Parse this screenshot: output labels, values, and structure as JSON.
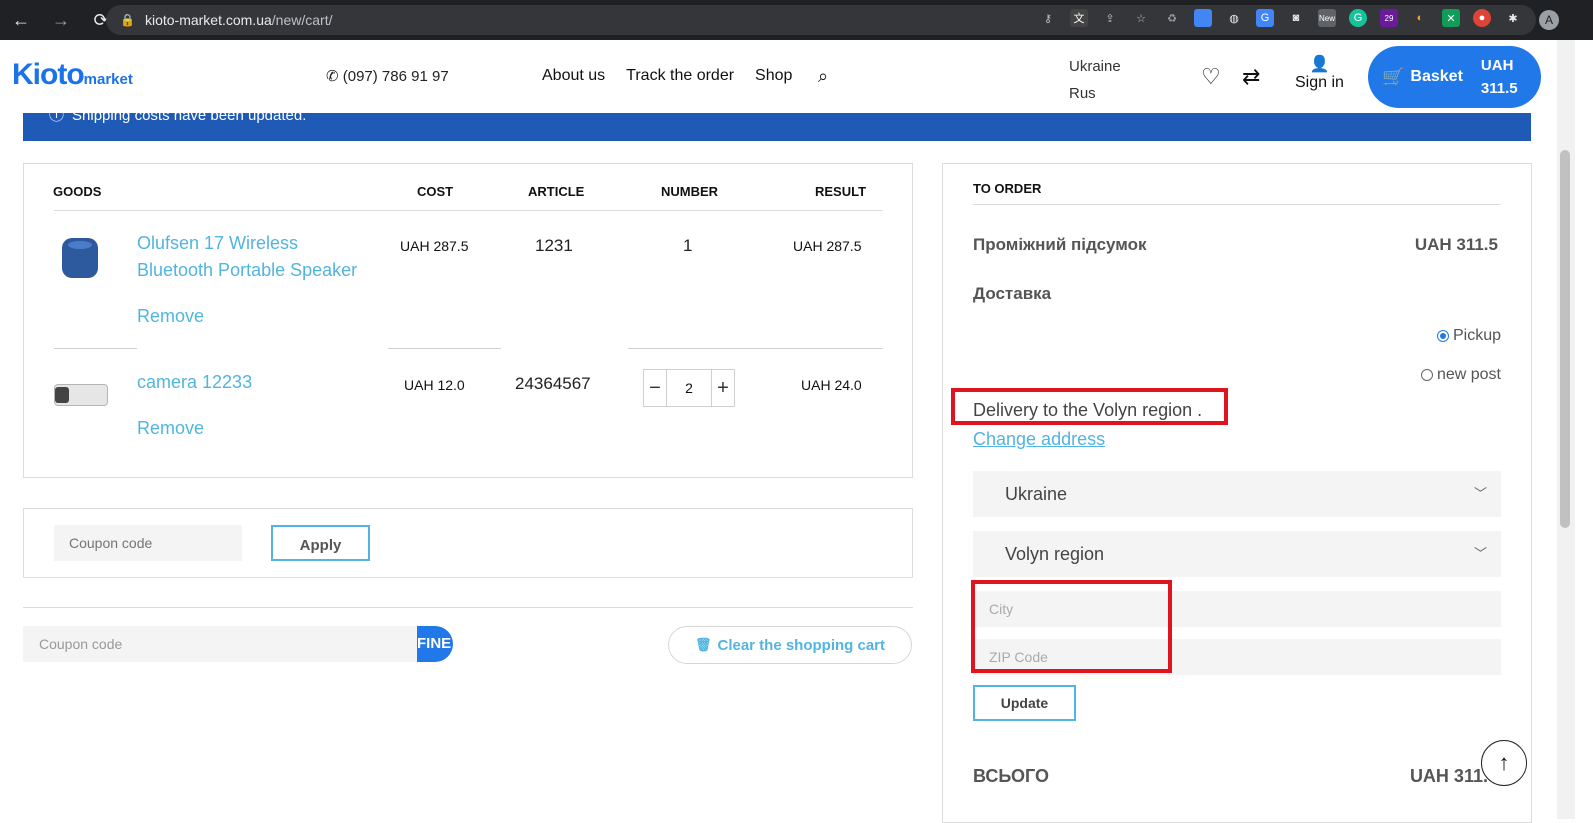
{
  "browser": {
    "url_host": "kioto-market.com.ua",
    "url_path": "/new/cart/",
    "ext_badge_new": "New",
    "ext_badge_count": "29",
    "profile_initial": "A"
  },
  "header": {
    "logo_main": "Kioto",
    "logo_sub": "market",
    "phone": "(097) 786 91 97",
    "nav": [
      "About us",
      "Track the order",
      "Shop"
    ],
    "lang_country": "Ukraine",
    "lang_language": "Rus",
    "signin": "Sign in",
    "basket_label": "Basket",
    "basket_currency": "UAH",
    "basket_amount": "311.5"
  },
  "notice": {
    "text": "Shipping costs have been updated."
  },
  "cart": {
    "columns": [
      "GOODS",
      "COST",
      "ARTICLE",
      "NUMBER",
      "RESULT"
    ],
    "rows": [
      {
        "name_line1": "Olufsen 17 Wireless",
        "name_line2": "Bluetooth Portable Speaker",
        "cost": "UAH 287.5",
        "article": "1231",
        "number": "1",
        "result": "UAH 287.5",
        "remove": "Remove"
      },
      {
        "name_line1": "camera 12233",
        "cost": "UAH 12.0",
        "article": "24364567",
        "number": "2",
        "result": "UAH 24.0",
        "remove": "Remove"
      }
    ],
    "stepper_minus": "−",
    "stepper_plus": "+"
  },
  "coupon": {
    "placeholder": "Coupon code",
    "apply": "Apply"
  },
  "bottom": {
    "coupon_placeholder": "Coupon code",
    "fine": "FINE",
    "clear": "Clear the shopping cart"
  },
  "order": {
    "title": "TO ORDER",
    "subtotal_label": "Проміжний підсумок",
    "subtotal_value": "UAH 311.5",
    "delivery_label": "Доставка",
    "options": [
      "Pickup",
      "new post"
    ],
    "delivery_to": "Delivery to the Volyn region .",
    "change_address": "Change address",
    "country": "Ukraine",
    "region": "Volyn region",
    "city_placeholder": "City",
    "zip_placeholder": "ZIP Code",
    "update": "Update",
    "total_label": "ВСЬОГО",
    "total_value": "UAH 311.5"
  },
  "colors": {
    "accent": "#2178e8",
    "link": "#52b4e0",
    "highlight": "#e0141e",
    "notice": "#1f5bb6"
  }
}
